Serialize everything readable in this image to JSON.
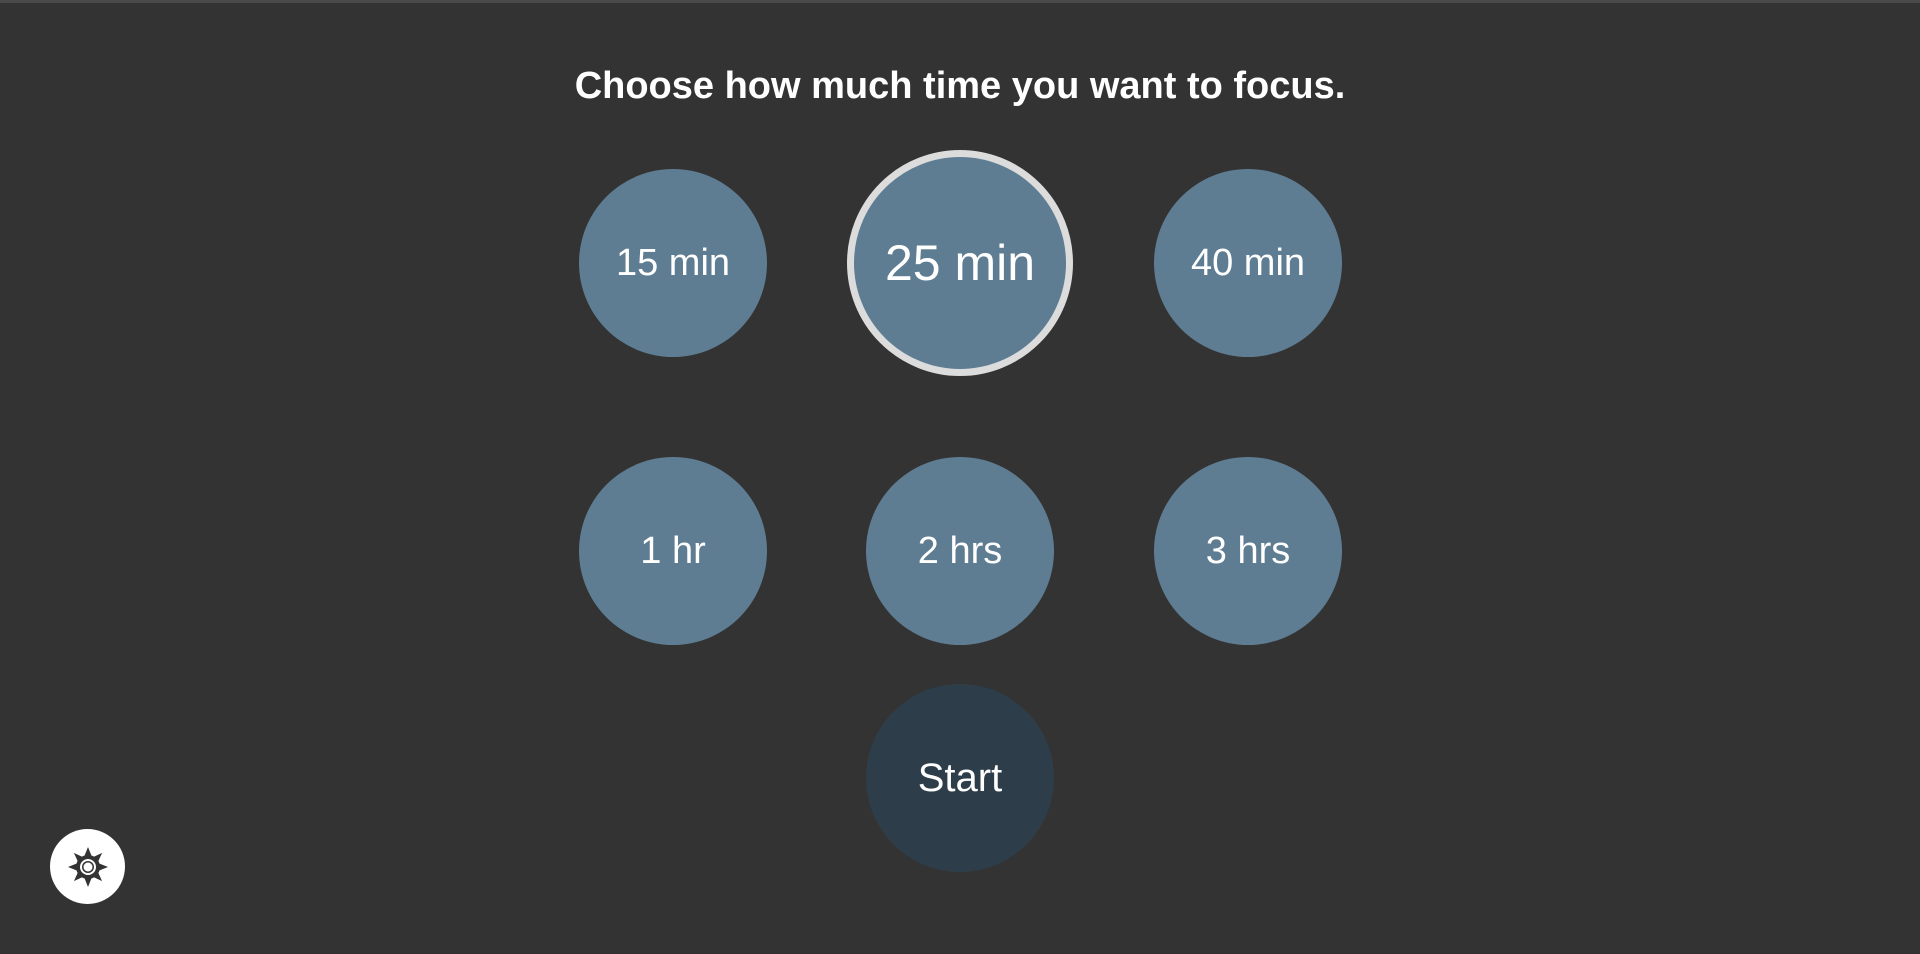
{
  "heading": "Choose how much time you want to focus.",
  "options": [
    {
      "label": "15 min",
      "selected": false
    },
    {
      "label": "25 min",
      "selected": true
    },
    {
      "label": "40 min",
      "selected": false
    },
    {
      "label": "1 hr",
      "selected": false
    },
    {
      "label": "2 hrs",
      "selected": false
    },
    {
      "label": "3 hrs",
      "selected": false
    }
  ],
  "start_label": "Start",
  "settings_icon": "gear-icon",
  "colors": {
    "background": "#333333",
    "option": "#5e7d93",
    "start": "#2d3e4a",
    "selected_ring": "#dcdcdc"
  }
}
